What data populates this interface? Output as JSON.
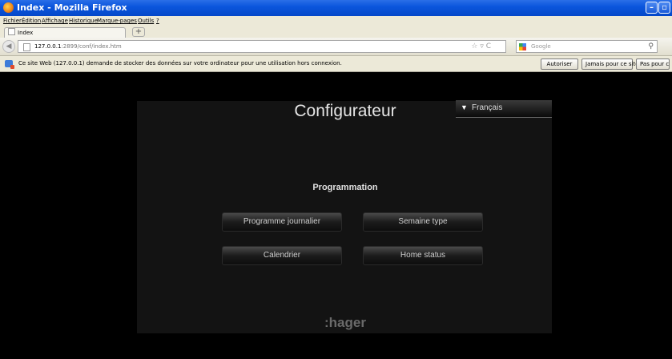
{
  "window": {
    "title": "Index - Mozilla Firefox",
    "minimize_glyph": "–",
    "maximize_glyph": "▫"
  },
  "menu": [
    "Fichier",
    "Édition",
    "Affichage",
    "Historique",
    "Marque-pages",
    "Outils",
    "?"
  ],
  "tab": {
    "label": "Index",
    "new_tab_label": "+"
  },
  "nav": {
    "back_glyph": "◀",
    "url_host": "127.0.0.1",
    "url_rest": ":2899/conf/index.htm",
    "star_glyph": "☆ ▿ C",
    "search_placeholder": "Google",
    "search_glyph": "⚲"
  },
  "notification": {
    "message": "Ce site Web (127.0.0.1) demande de stocker des données sur votre ordinateur pour une utilisation hors connexion.",
    "allow": "Autoriser",
    "never": "Jamais pour ce site",
    "not_now": "Pas pour cette fois"
  },
  "page": {
    "heading": "Configurateur",
    "language": "Français",
    "language_arrow": "▼",
    "section": "Programmation",
    "buttons": [
      "Programme journalier",
      "Semaine type",
      "Calendrier",
      "Home status"
    ],
    "logo": ":hager"
  },
  "colors": {
    "titlebar": "#0b56dd",
    "page_bg": "#000000",
    "panel_bg": "#131313",
    "button_text": "#cfcfcf"
  }
}
